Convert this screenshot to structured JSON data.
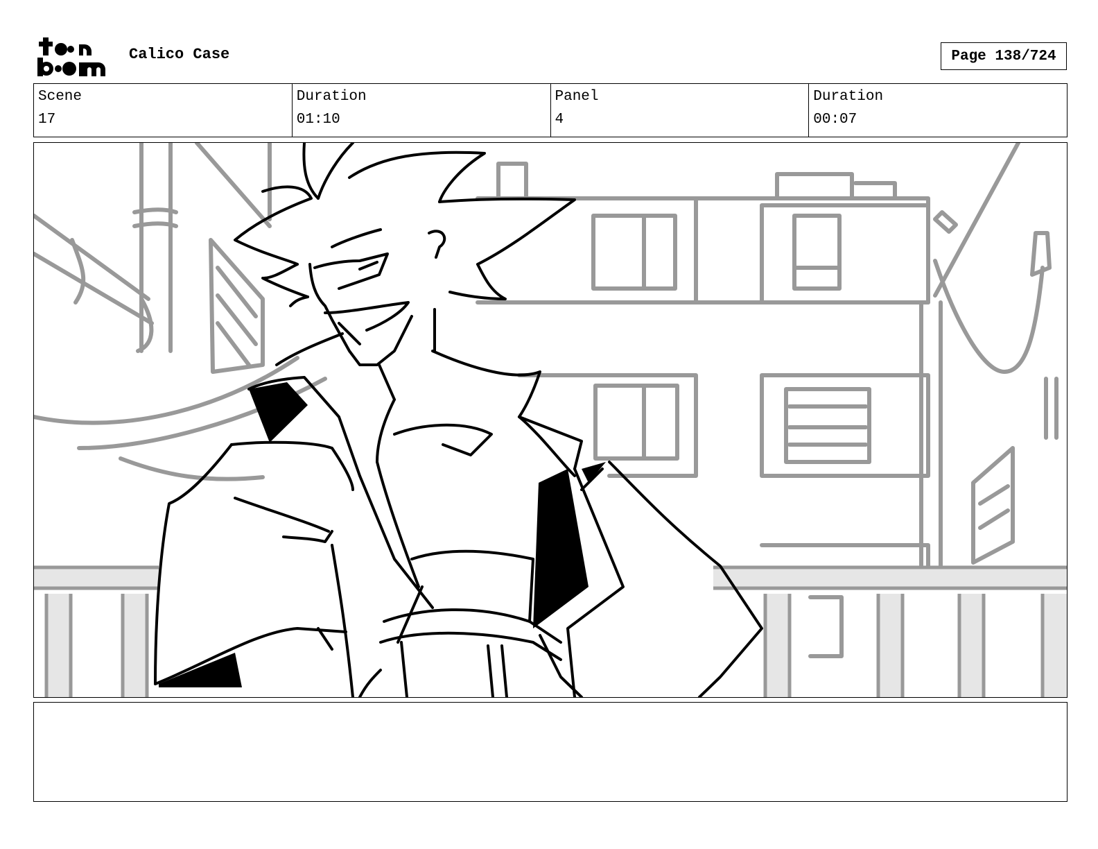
{
  "header": {
    "logo_text_top": "toon",
    "logo_text_bottom": "boom",
    "project_title": "Calico Case",
    "page_label": "Page 138/724"
  },
  "info": {
    "scene_label": "Scene",
    "scene_value": "17",
    "scene_duration_label": "Duration",
    "scene_duration_value": "01:10",
    "panel_label": "Panel",
    "panel_value": "4",
    "panel_duration_label": "Duration",
    "panel_duration_value": "00:07"
  },
  "panel": {
    "image_name": "storyboard-sketch",
    "line_color": "#000000",
    "background_line_color": "#999999",
    "railing_fill": "#e6e6e6"
  },
  "notes": {
    "text": ""
  }
}
